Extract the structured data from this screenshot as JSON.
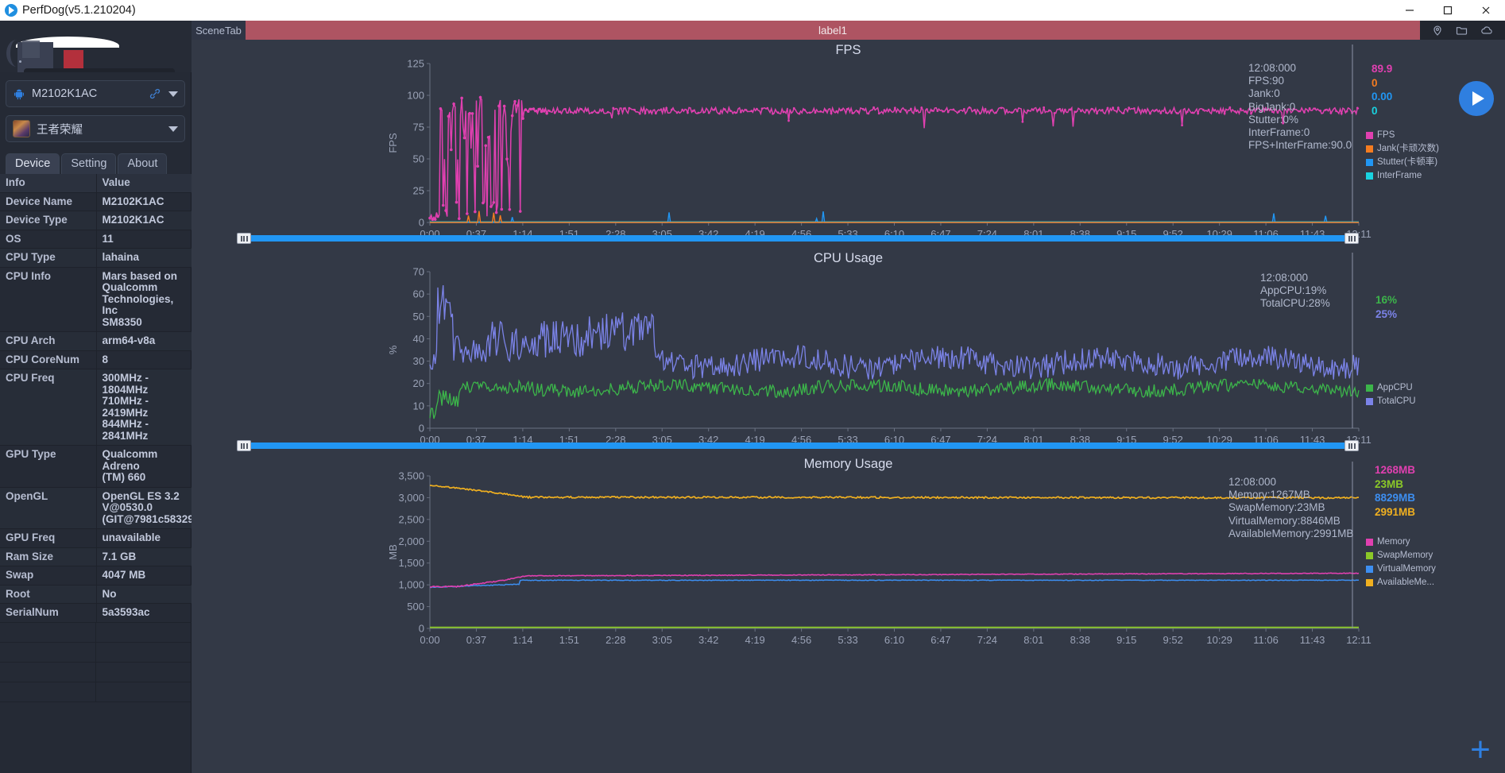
{
  "window": {
    "title": "PerfDog(v5.1.210204)",
    "logo_icon": "perfdog-logo-icon",
    "minimize_label": "–",
    "maximize_label": "☐",
    "close_label": "✕"
  },
  "sidebar": {
    "device_combo": {
      "icon": "android-icon",
      "label": "M2102K1AC",
      "link_icon": "usb-link-icon",
      "caret_icon": "chevron-down-icon"
    },
    "app_combo": {
      "icon": "game-app-icon",
      "label": "王者荣耀",
      "caret_icon": "chevron-down-icon"
    },
    "tabs": [
      {
        "label": "Device",
        "active": true
      },
      {
        "label": "Setting",
        "active": false
      },
      {
        "label": "About",
        "active": false
      }
    ],
    "table": {
      "headers": [
        "Info",
        "Value"
      ],
      "rows": [
        {
          "info": "Device Name",
          "value": "M2102K1AC"
        },
        {
          "info": "Device Type",
          "value": "M2102K1AC"
        },
        {
          "info": "OS",
          "value": "11"
        },
        {
          "info": "CPU Type",
          "value": "lahaina"
        },
        {
          "info": "CPU Info",
          "value": "Mars based on\nQualcomm\nTechnologies, Inc\nSM8350"
        },
        {
          "info": "CPU Arch",
          "value": "arm64-v8a"
        },
        {
          "info": "CPU CoreNum",
          "value": "8"
        },
        {
          "info": "CPU Freq",
          "value": "300MHz - 1804MHz\n710MHz - 2419MHz\n844MHz - 2841MHz"
        },
        {
          "info": "GPU Type",
          "value": "Qualcomm Adreno\n(TM) 660"
        },
        {
          "info": "OpenGL",
          "value": "OpenGL ES 3.2\nV@0530.0\n(GIT@7981c58329"
        },
        {
          "info": "GPU Freq",
          "value": "unavailable"
        },
        {
          "info": "Ram Size",
          "value": "7.1 GB"
        },
        {
          "info": "Swap",
          "value": "4047 MB"
        },
        {
          "info": "Root",
          "value": "No"
        },
        {
          "info": "SerialNum",
          "value": "5a3593ac"
        }
      ]
    }
  },
  "scenebar": {
    "scene_tab_label": "SceneTab",
    "label_tab_label": "label1",
    "icons": [
      "location-pin-icon",
      "folder-icon",
      "cloud-upload-icon"
    ]
  },
  "controls": {
    "play_label": "play-button",
    "plus_label": "+"
  },
  "xaxis": {
    "ticks": [
      "0:00",
      "0:37",
      "1:14",
      "1:51",
      "2:28",
      "3:05",
      "3:42",
      "4:19",
      "4:56",
      "5:33",
      "6:10",
      "6:47",
      "7:24",
      "8:01",
      "8:38",
      "9:15",
      "9:52",
      "10:29",
      "11:06",
      "11:43",
      "12:11"
    ]
  },
  "chart_data": [
    {
      "type": "line",
      "title": "FPS",
      "xlabel": "",
      "ylabel": "FPS",
      "ylim": [
        0,
        125
      ],
      "yticks": [
        0,
        25,
        50,
        75,
        100,
        125
      ],
      "xticks": [
        "0:00",
        "0:37",
        "1:14",
        "1:51",
        "2:28",
        "3:05",
        "3:42",
        "4:19",
        "4:56",
        "5:33",
        "6:10",
        "6:47",
        "7:24",
        "8:01",
        "8:38",
        "9:15",
        "9:52",
        "10:29",
        "11:06",
        "11:43",
        "12:11"
      ],
      "grid": false,
      "legend_position": "right",
      "series": [
        {
          "name": "FPS",
          "color": "#e040b0"
        },
        {
          "name": "Jank(卡顽次数)",
          "color": "#f57c20"
        },
        {
          "name": "Stutter(卡顿率)",
          "color": "#2196f3"
        },
        {
          "name": "InterFrame",
          "color": "#19d2e0"
        }
      ],
      "readout": {
        "timestamp": "12:08:000",
        "lines": [
          "FPS:90",
          "Jank:0",
          "BigJank:0",
          "Stutter:0%",
          "InterFrame:0",
          "FPS+InterFrame:90.0"
        ]
      },
      "current_values": [
        {
          "value": "89.9",
          "color": "#e040b0"
        },
        {
          "value": "0",
          "color": "#f57c20"
        },
        {
          "value": "0.00",
          "color": "#2196f3"
        },
        {
          "value": "0",
          "color": "#19d2e0"
        }
      ]
    },
    {
      "type": "line",
      "title": "CPU Usage",
      "xlabel": "",
      "ylabel": "%",
      "ylim": [
        0,
        70
      ],
      "yticks": [
        0,
        10,
        20,
        30,
        40,
        50,
        60,
        70
      ],
      "xticks": [
        "0:00",
        "0:37",
        "1:14",
        "1:51",
        "2:28",
        "3:05",
        "3:42",
        "4:19",
        "4:56",
        "5:33",
        "6:10",
        "6:47",
        "7:24",
        "8:01",
        "8:38",
        "9:15",
        "9:52",
        "10:29",
        "11:06",
        "11:43",
        "12:11"
      ],
      "grid": false,
      "legend_position": "right",
      "series": [
        {
          "name": "AppCPU",
          "color": "#3cb54a"
        },
        {
          "name": "TotalCPU",
          "color": "#7b83e8"
        }
      ],
      "readout": {
        "timestamp": "12:08:000",
        "lines": [
          "AppCPU:19%",
          "TotalCPU:28%"
        ]
      },
      "current_values": [
        {
          "value": "16%",
          "color": "#3cb54a"
        },
        {
          "value": "25%",
          "color": "#7b83e8"
        }
      ]
    },
    {
      "type": "line",
      "title": "Memory Usage",
      "xlabel": "",
      "ylabel": "MB",
      "ylim": [
        0,
        3500
      ],
      "yticks": [
        0,
        500,
        1000,
        1500,
        2000,
        2500,
        3000,
        3500
      ],
      "ytick_labels": [
        "0",
        "500",
        "1,000",
        "1,500",
        "2,000",
        "2,500",
        "3,000",
        "3,500"
      ],
      "xticks": [
        "0:00",
        "0:37",
        "1:14",
        "1:51",
        "2:28",
        "3:05",
        "3:42",
        "4:19",
        "4:56",
        "5:33",
        "6:10",
        "6:47",
        "7:24",
        "8:01",
        "8:38",
        "9:15",
        "9:52",
        "10:29",
        "11:06",
        "11:43",
        "12:11"
      ],
      "grid": false,
      "legend_position": "right",
      "series": [
        {
          "name": "Memory",
          "color": "#e040b0"
        },
        {
          "name": "SwapMemory",
          "color": "#8bc828"
        },
        {
          "name": "VirtualMemory",
          "color": "#3d8ef0"
        },
        {
          "name": "AvailableMe...",
          "color": "#f0b020"
        }
      ],
      "readout": {
        "timestamp": "12:08:000",
        "lines": [
          "Memory:1267MB",
          "SwapMemory:23MB",
          "VirtualMemory:8846MB",
          "AvailableMemory:2991MB"
        ]
      },
      "current_values": [
        {
          "value": "1268MB",
          "color": "#e040b0"
        },
        {
          "value": "23MB",
          "color": "#8bc828"
        },
        {
          "value": "8829MB",
          "color": "#3d8ef0"
        },
        {
          "value": "2991MB",
          "color": "#f0b020"
        }
      ]
    }
  ]
}
